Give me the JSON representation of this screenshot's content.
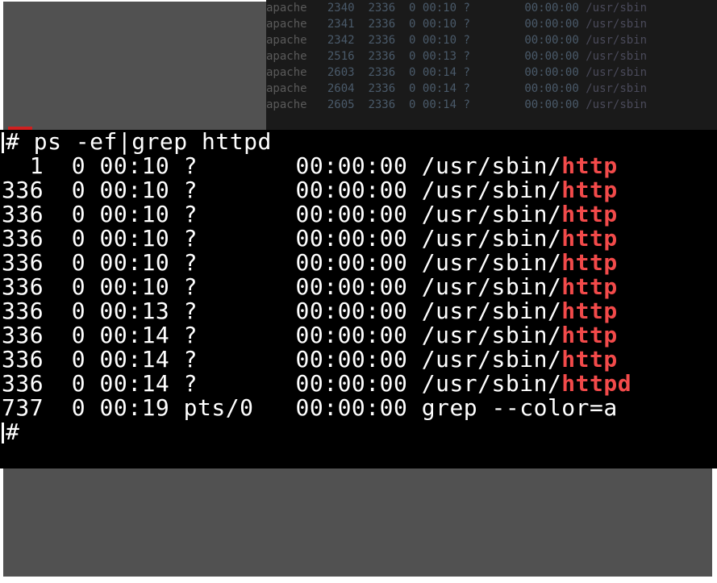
{
  "faded_rows": [
    {
      "user": "apache",
      "pid": "2340",
      "ppid": "2336",
      "c": "0",
      "stime": "00:10",
      "tty": "?",
      "time": "00:00:00",
      "cmd": "/usr/sbin"
    },
    {
      "user": "apache",
      "pid": "2341",
      "ppid": "2336",
      "c": "0",
      "stime": "00:10",
      "tty": "?",
      "time": "00:00:00",
      "cmd": "/usr/sbin"
    },
    {
      "user": "apache",
      "pid": "2342",
      "ppid": "2336",
      "c": "0",
      "stime": "00:10",
      "tty": "?",
      "time": "00:00:00",
      "cmd": "/usr/sbin"
    },
    {
      "user": "apache",
      "pid": "2516",
      "ppid": "2336",
      "c": "0",
      "stime": "00:13",
      "tty": "?",
      "time": "00:00:00",
      "cmd": "/usr/sbin"
    },
    {
      "user": "apache",
      "pid": "2603",
      "ppid": "2336",
      "c": "0",
      "stime": "00:14",
      "tty": "?",
      "time": "00:00:00",
      "cmd": "/usr/sbin"
    },
    {
      "user": "apache",
      "pid": "2604",
      "ppid": "2336",
      "c": "0",
      "stime": "00:14",
      "tty": "?",
      "time": "00:00:00",
      "cmd": "/usr/sbin"
    },
    {
      "user": "apache",
      "pid": "2605",
      "ppid": "2336",
      "c": "0",
      "stime": "00:14",
      "tty": "?",
      "time": "00:00:00",
      "cmd": "/usr/sbin"
    }
  ],
  "command_line": {
    "prompt": "#",
    "command": "ps -ef|grep httpd"
  },
  "rows": [
    {
      "ppid": "  1",
      "c": "0",
      "stime": "00:10",
      "tty": "?    ",
      "time": "00:00:00",
      "path": "/usr/sbin/",
      "hl": "http"
    },
    {
      "ppid": "336",
      "c": "0",
      "stime": "00:10",
      "tty": "?    ",
      "time": "00:00:00",
      "path": "/usr/sbin/",
      "hl": "http"
    },
    {
      "ppid": "336",
      "c": "0",
      "stime": "00:10",
      "tty": "?    ",
      "time": "00:00:00",
      "path": "/usr/sbin/",
      "hl": "http"
    },
    {
      "ppid": "336",
      "c": "0",
      "stime": "00:10",
      "tty": "?    ",
      "time": "00:00:00",
      "path": "/usr/sbin/",
      "hl": "http"
    },
    {
      "ppid": "336",
      "c": "0",
      "stime": "00:10",
      "tty": "?    ",
      "time": "00:00:00",
      "path": "/usr/sbin/",
      "hl": "http"
    },
    {
      "ppid": "336",
      "c": "0",
      "stime": "00:10",
      "tty": "?    ",
      "time": "00:00:00",
      "path": "/usr/sbin/",
      "hl": "http"
    },
    {
      "ppid": "336",
      "c": "0",
      "stime": "00:13",
      "tty": "?    ",
      "time": "00:00:00",
      "path": "/usr/sbin/",
      "hl": "http"
    },
    {
      "ppid": "336",
      "c": "0",
      "stime": "00:14",
      "tty": "?    ",
      "time": "00:00:00",
      "path": "/usr/sbin/",
      "hl": "http"
    },
    {
      "ppid": "336",
      "c": "0",
      "stime": "00:14",
      "tty": "?    ",
      "time": "00:00:00",
      "path": "/usr/sbin/",
      "hl": "http"
    },
    {
      "ppid": "336",
      "c": "0",
      "stime": "00:14",
      "tty": "?    ",
      "time": "00:00:00",
      "path": "/usr/sbin/",
      "hl": "httpd"
    }
  ],
  "grep_row": {
    "ppid": "737",
    "c": "0",
    "stime": "00:19",
    "tty": "pts/0",
    "time": "00:00:00",
    "tail": "grep --color=a"
  },
  "final_prompt": "#"
}
